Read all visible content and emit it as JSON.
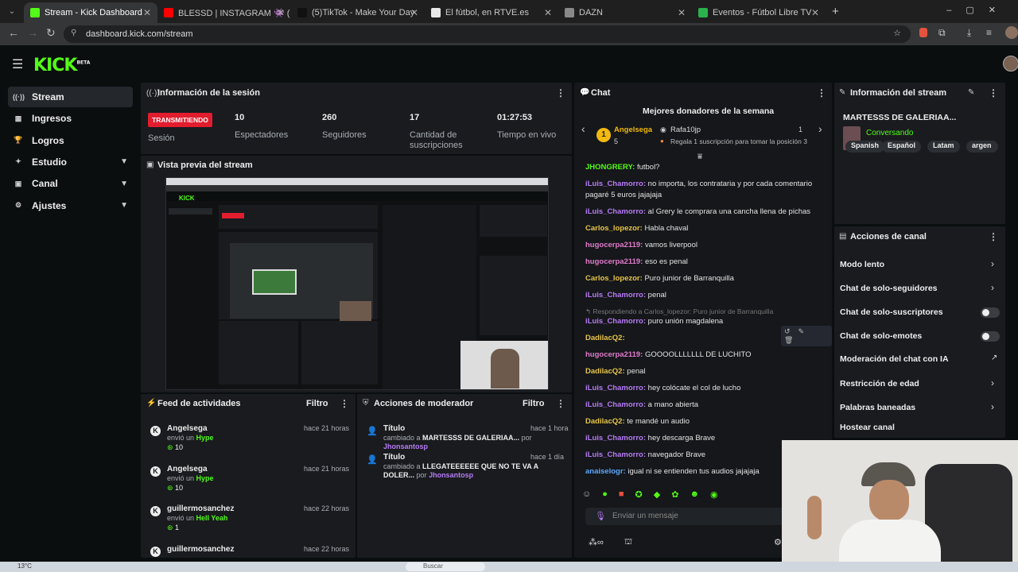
{
  "tabs": [
    {
      "title": "Stream - Kick Dashboard",
      "active": true,
      "color": "#53fc18"
    },
    {
      "title": "BLESSD | INSTAGRAM 👾 ( OFI",
      "active": false,
      "color": "#ff0000"
    },
    {
      "title": "(5)TikTok - Make Your Day",
      "active": false,
      "color": "#111111"
    },
    {
      "title": "El fútbol, en RTVE.es",
      "active": false,
      "color": "#e8e8e8"
    },
    {
      "title": "DAZN",
      "active": false,
      "color": "#888888"
    },
    {
      "title": "Eventos - Fútbol Libre TV",
      "active": false,
      "color": "#2bb24c"
    }
  ],
  "address": {
    "url": "dashboard.kick.com/stream"
  },
  "logo": {
    "text": "KICK",
    "badge": "BETA"
  },
  "sidebar": {
    "items": [
      {
        "label": "Stream",
        "icon": "broadcast-icon",
        "glyph": "((·))",
        "active": true
      },
      {
        "label": "Ingresos",
        "icon": "revenue-icon",
        "glyph": "▦",
        "active": false
      },
      {
        "label": "Logros",
        "icon": "trophy-icon",
        "glyph": "🏆",
        "active": false
      },
      {
        "label": "Estudio",
        "icon": "studio-icon",
        "glyph": "✦",
        "active": false,
        "chevron": true
      },
      {
        "label": "Canal",
        "icon": "channel-icon",
        "glyph": "▣",
        "active": false,
        "chevron": true
      },
      {
        "label": "Ajustes",
        "icon": "gear-icon",
        "glyph": "⚙",
        "active": false,
        "chevron": true
      }
    ]
  },
  "session": {
    "title": "Información de la sesión",
    "status": "TRANSMITIENDO",
    "status_label": "Sesión",
    "viewers": "10",
    "viewers_label": "Espectadores",
    "followers": "260",
    "followers_label": "Seguidores",
    "subs": "17",
    "subs_label": "Cantidad de suscripciones",
    "time": "01:27:53",
    "time_label": "Tiempo en vivo"
  },
  "preview": {
    "title": "Vista previa del stream"
  },
  "feed": {
    "title": "Feed de actividades",
    "filter": "Filtro",
    "items": [
      {
        "name": "Angelsega",
        "action": "envió un",
        "highlight": "Hype",
        "amount": "10",
        "time": "hace 21 horas"
      },
      {
        "name": "Angelsega",
        "action": "envió un",
        "highlight": "Hype",
        "amount": "10",
        "time": "hace 21 horas"
      },
      {
        "name": "guillermosanchez",
        "action": "envió un",
        "highlight": "Hell Yeah",
        "amount": "1",
        "time": "hace 22 horas"
      },
      {
        "name": "guillermosanchez",
        "action": "",
        "highlight": "",
        "amount": "",
        "time": "hace 22 horas"
      }
    ]
  },
  "modactions": {
    "title": "Acciones de moderador",
    "filter": "Filtro",
    "items": [
      {
        "field": "Título",
        "text": "cambiado a",
        "value": "MARTESSS DE GALERIAA...",
        "by": "por",
        "user": "Jhonsantosp",
        "time": "hace 1 hora"
      },
      {
        "field": "Título",
        "text": "cambiado a",
        "value": "LLEGATEEEEEE QUE NO TE VA A DOLER...",
        "by": "por",
        "user": "Jhonsantosp",
        "time": "hace 1 día"
      }
    ]
  },
  "chat": {
    "title": "Chat",
    "donors_title": "Mejores donadores de la semana",
    "donor1": {
      "rank": "1",
      "name": "Angelsega",
      "amount": "5"
    },
    "donor2": {
      "name": "Rafa10jp",
      "amount": "1",
      "promo": "Regala 1 suscripción para tomar la posición 3"
    },
    "messages": [
      {
        "user": "JHONGRERY:",
        "text": "futbol?",
        "color": "#53fc18"
      },
      {
        "user": "iLuis_Chamorro:",
        "text": "no importa, los contrataria y por cada comentario pagaré 5 euros jajajaja",
        "color": "#b67bf5"
      },
      {
        "user": "iLuis_Chamorro:",
        "text": "al Grery le comprara una cancha llena de pichas",
        "color": "#b67bf5"
      },
      {
        "user": "Carlos_lopezor:",
        "text": "Habla chaval",
        "color": "#e8c547"
      },
      {
        "user": "hugocerpa2119:",
        "text": "vamos liverpool",
        "color": "#e07acb"
      },
      {
        "user": "hugocerpa2119:",
        "text": "eso es penal",
        "color": "#e07acb"
      },
      {
        "user": "Carlos_lopezor:",
        "text": "Puro junior de Barranquilla",
        "color": "#e8c547"
      },
      {
        "user": "iLuis_Chamorro:",
        "text": "penal",
        "color": "#b67bf5"
      },
      {
        "user": "",
        "text": "↰ Respondiendo a Carlos_lopezor: Puro junior de Barranquilla",
        "color": "#777"
      },
      {
        "user": "iLuis_Chamorro:",
        "text": "puro unión magdalena",
        "color": "#b67bf5"
      },
      {
        "user": "DadilacQ2:",
        "text": "",
        "color": "#e8c547"
      },
      {
        "user": "hugocerpa2119:",
        "text": "GOOOOLLLLLLL DE LUCHITO",
        "color": "#e07acb"
      },
      {
        "user": "DadilacQ2:",
        "text": "penal",
        "color": "#e8c547"
      },
      {
        "user": "iLuis_Chamorro:",
        "text": "hey colócate el col de lucho",
        "color": "#b67bf5"
      },
      {
        "user": "iLuis_Chamorro:",
        "text": "a mano abierta",
        "color": "#b67bf5"
      },
      {
        "user": "DadilacQ2:",
        "text": "te mandé un audio",
        "color": "#e8c547"
      },
      {
        "user": "iLuis_Chamorro:",
        "text": "hey descarga Brave",
        "color": "#b67bf5"
      },
      {
        "user": "iLuis_Chamorro:",
        "text": "navegador Brave",
        "color": "#b67bf5"
      },
      {
        "user": "anaiselogr:",
        "text": "igual ni se entienden tus audios jajajaja",
        "color": "#5aa9ff"
      }
    ],
    "input_placeholder": "Enviar un mensaje"
  },
  "streaminfo": {
    "title": "Información del stream",
    "stream_title": "MARTESSS DE GALERIAA...",
    "category": "Conversando",
    "tags": [
      "Spanish",
      "Español",
      "Latam",
      "argen"
    ]
  },
  "canal": {
    "title": "Acciones de canal",
    "items": [
      {
        "label": "Modo lento",
        "type": "arrow"
      },
      {
        "label": "Chat de solo-seguidores",
        "type": "arrow"
      },
      {
        "label": "Chat de solo-suscriptores",
        "type": "toggle"
      },
      {
        "label": "Chat de solo-emotes",
        "type": "toggle"
      },
      {
        "label": "Moderación del chat con IA",
        "type": "link"
      },
      {
        "label": "Restricción de edad",
        "type": "arrow"
      },
      {
        "label": "Palabras baneadas",
        "type": "arrow"
      },
      {
        "label": "Hostear canal",
        "type": "none"
      }
    ]
  },
  "taskbar": {
    "weather": "13°C",
    "search": "Buscar"
  }
}
